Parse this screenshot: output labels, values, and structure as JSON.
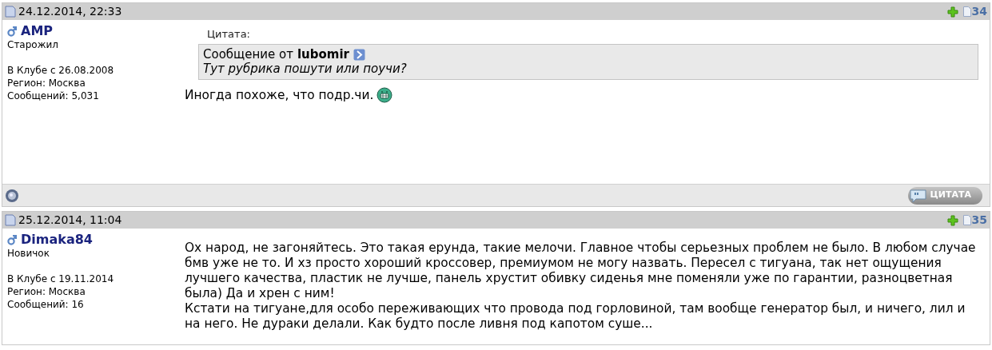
{
  "posts": [
    {
      "date": "24.12.2014, 22:33",
      "number": "34",
      "author": {
        "name": "AMP",
        "rank": "Старожил",
        "joined": "В Клубе с 26.08.2008",
        "region": "Регион: Москва",
        "messages": "Сообщений: 5,031"
      },
      "quote": {
        "label": "Цитата:",
        "prefix": "Сообщение от",
        "author": "lubomir",
        "text": "Тут рубрика пошути или поучи?"
      },
      "message": [
        "Иногда похоже, что подр.чи."
      ],
      "smiley": true,
      "quote_button": "ЦИТАТА"
    },
    {
      "date": "25.12.2014, 11:04",
      "number": "35",
      "author": {
        "name": "Dimaka84",
        "rank": "Новичок",
        "joined": "В Клубе с 19.11.2014",
        "region": "Регион: Москва",
        "messages": "Сообщений: 16"
      },
      "message": [
        "Ох народ, не загоняйтесь. Это такая ерунда, такие мелочи. Главное чтобы серьезных проблем не было. В любом случае бмв уже не то. И хз просто хороший кроссовер, премиумом не могу назвать. Пересел с тигуана, так нет ощущения лучшего качества, пластик не лучше, панель хрустит обивку сиденья мне поменяли уже по гарантии, разноцветная была) Да и хрен с ним!",
        "Кстати на тигуане,для особо переживающих что провода под горловиной, там вообще генератор был, и ничего, лил и на него. Не дураки делали. Как будто после ливня под капотом суше..."
      ],
      "smiley": false
    }
  ]
}
